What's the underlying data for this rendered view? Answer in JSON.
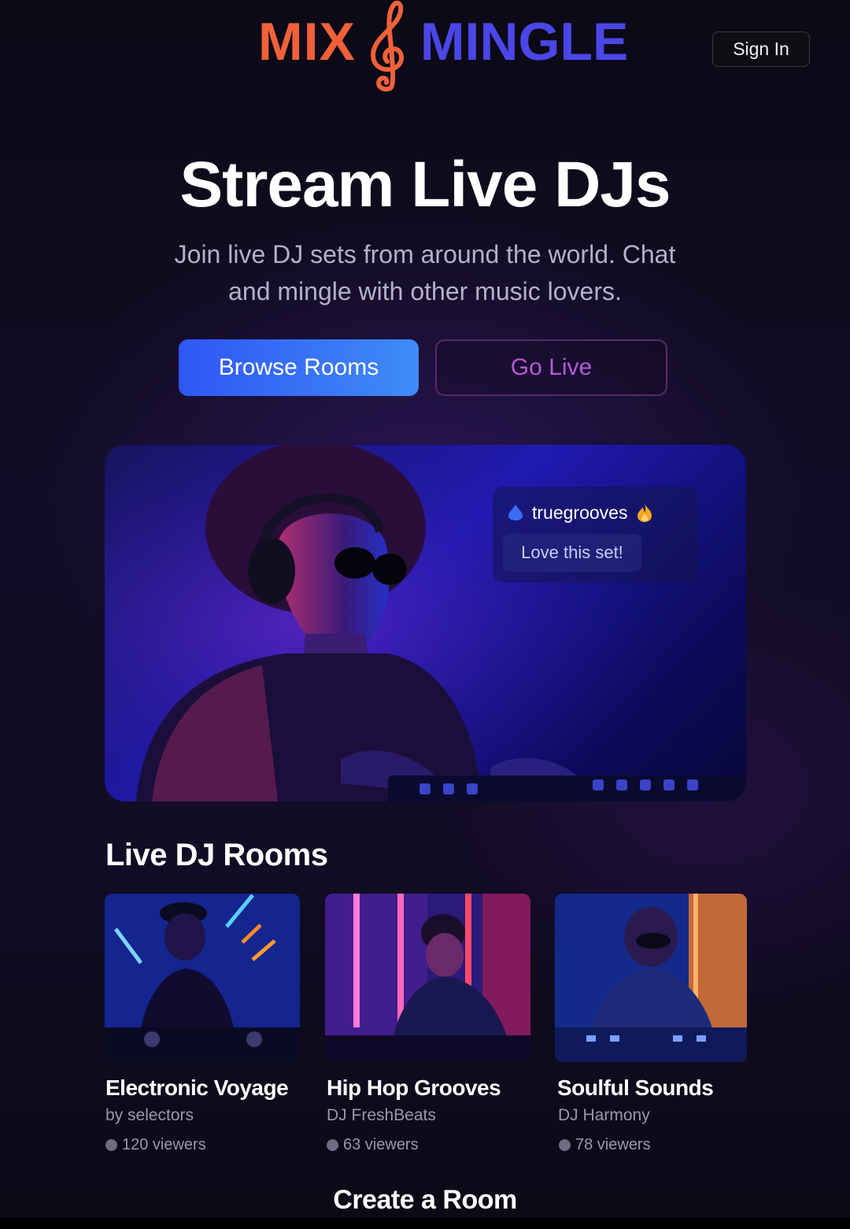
{
  "header": {
    "logo_left": "MIX",
    "logo_right": "MINGLE",
    "signin_label": "Sign In"
  },
  "hero": {
    "title": "Stream Live DJs",
    "subtitle_line1": "Join live DJ sets from around the world. Chat",
    "subtitle_line2": "and mingle with other music lovers.",
    "browse_label": "Browse Rooms",
    "golive_label": "Go Live"
  },
  "chat": {
    "username": "truegrooves",
    "message": "Love this set!",
    "icons": [
      "drop-icon",
      "fire-icon"
    ]
  },
  "rooms_section": {
    "title": "Live DJ Rooms",
    "rooms": [
      {
        "title": "Electronic Voyage",
        "dj": "by selectors",
        "viewers": "120 viewers"
      },
      {
        "title": "Hip Hop Grooves",
        "dj": "DJ FreshBeats",
        "viewers": "63 viewers"
      },
      {
        "title": "Soulful Sounds",
        "dj": "DJ Harmony",
        "viewers": "78 viewers"
      }
    ]
  },
  "footer": {
    "create_room_label": "Create a Room"
  },
  "colors": {
    "brand_orange": "#f0613a",
    "brand_indigo": "#4b46e6",
    "primary_blue": "#2f56f5",
    "accent_magenta": "#b658d8",
    "background": "#0c0a18"
  }
}
